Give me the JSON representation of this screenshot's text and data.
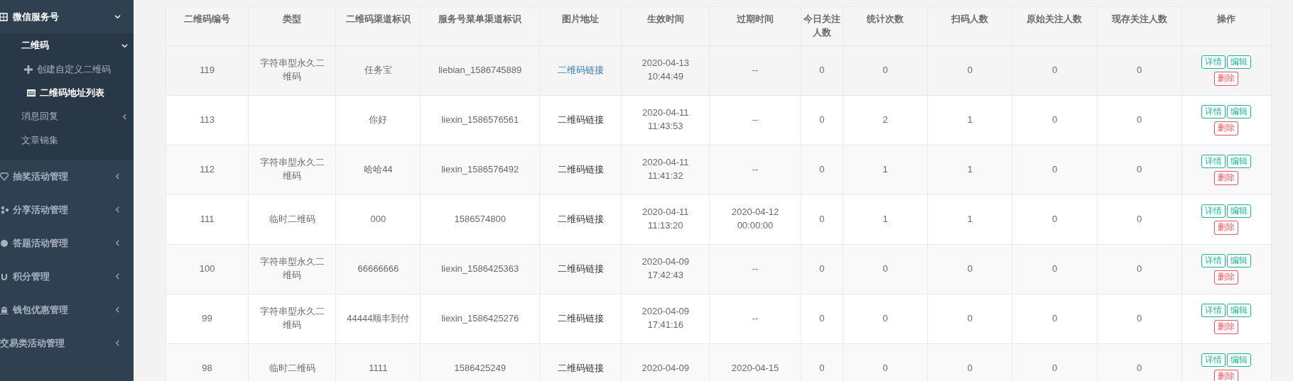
{
  "sidebar": {
    "items": [
      {
        "label": "微信服务号",
        "expanded": true,
        "children": [
          {
            "label": "二维码",
            "expanded": true,
            "children": [
              {
                "label": "创建自定义二维码",
                "selected": false
              },
              {
                "label": "二维码地址列表",
                "selected": true
              }
            ]
          },
          {
            "label": "消息回复",
            "expanded": false
          },
          {
            "label": "文章锦集"
          }
        ]
      },
      {
        "label": "抽奖活动管理",
        "expanded": false
      },
      {
        "label": "分享活动管理",
        "expanded": false
      },
      {
        "label": "答题活动管理",
        "expanded": false
      },
      {
        "label": "积分管理",
        "expanded": false
      },
      {
        "label": "钱包优惠管理",
        "expanded": false
      },
      {
        "label": "交易类活动管理",
        "expanded": false
      }
    ]
  },
  "table": {
    "columns": [
      "二维码编号",
      "类型",
      "二维码渠道标识",
      "服务号菜单渠道标识",
      "图片地址",
      "生效时间",
      "过期时间",
      "今日关注人数",
      "统计次数",
      "扫码人数",
      "原始关注人数",
      "现存关注人数",
      "操作"
    ],
    "rows": [
      {
        "cells": [
          "119",
          "字符串型永久二维码",
          "任务宝",
          "liebian_1586745889",
          {
            "link": "二维码链接",
            "highlighted": true
          },
          "2020-04-13 10:44:49",
          "--",
          "0",
          "0",
          "0",
          "0",
          "0"
        ],
        "actions": [
          {
            "kind": "detail",
            "label": "详情"
          },
          {
            "kind": "edit",
            "label": "编辑"
          },
          {
            "kind": "delete",
            "label": "删除"
          }
        ]
      },
      {
        "cells": [
          "113",
          null,
          "你好",
          "liexin_1586576561",
          {
            "link": "二维码链接",
            "highlighted": false
          },
          "2020-04-11 11:43:53",
          "--",
          "0",
          "2",
          "1",
          "0",
          "0"
        ],
        "actions": [
          {
            "kind": "detail",
            "label": "详情"
          },
          {
            "kind": "edit",
            "label": "编辑"
          },
          {
            "kind": "delete",
            "label": "删除"
          }
        ]
      },
      {
        "cells": [
          "112",
          "字符串型永久二维码",
          "哈哈44",
          "liexin_1586576492",
          {
            "link": "二维码链接",
            "highlighted": false
          },
          "2020-04-11 11:41:32",
          "--",
          "0",
          "1",
          "1",
          "0",
          "0"
        ],
        "actions": [
          {
            "kind": "detail",
            "label": "详情"
          },
          {
            "kind": "edit",
            "label": "编辑"
          },
          {
            "kind": "delete",
            "label": "删除"
          }
        ]
      },
      {
        "cells": [
          "111",
          "临时二维码",
          "000",
          "1586574800",
          {
            "link": "二维码链接",
            "highlighted": false
          },
          "2020-04-11 11:13:20",
          "2020-04-12 00:00:00",
          "0",
          "1",
          "1",
          "0",
          "0"
        ],
        "actions": [
          {
            "kind": "detail",
            "label": "详情"
          },
          {
            "kind": "edit",
            "label": "编辑"
          },
          {
            "kind": "delete",
            "label": "删除"
          }
        ]
      },
      {
        "cells": [
          "100",
          "字符串型永久二维码",
          "66666666",
          "liexin_1586425363",
          {
            "link": "二维码链接",
            "highlighted": false
          },
          "2020-04-09 17:42:43",
          "--",
          "0",
          "0",
          "0",
          "0",
          "0"
        ],
        "actions": [
          {
            "kind": "detail",
            "label": "详情"
          },
          {
            "kind": "edit",
            "label": "编辑"
          },
          {
            "kind": "delete",
            "label": "删除"
          }
        ]
      },
      {
        "cells": [
          "99",
          "字符串型永久二维码",
          "44444顺丰到付",
          "liexin_1586425276",
          {
            "link": "二维码链接",
            "highlighted": false
          },
          "2020-04-09 17:41:16",
          "--",
          "0",
          "0",
          "0",
          "0",
          "0"
        ],
        "actions": [
          {
            "kind": "detail",
            "label": "详情"
          },
          {
            "kind": "edit",
            "label": "编辑"
          },
          {
            "kind": "delete",
            "label": "删除"
          }
        ]
      },
      {
        "cells": [
          "98",
          "临时二维码",
          "1111",
          "1586425249",
          {
            "link": "二维码链接",
            "highlighted": false
          },
          "2020-04-09",
          "2020-04-15",
          "0",
          "0",
          "0",
          "0",
          "0"
        ],
        "actions": [
          {
            "kind": "detail",
            "label": "详情"
          },
          {
            "kind": "edit",
            "label": "编辑"
          },
          {
            "kind": "delete",
            "label": "删除"
          }
        ]
      }
    ]
  }
}
